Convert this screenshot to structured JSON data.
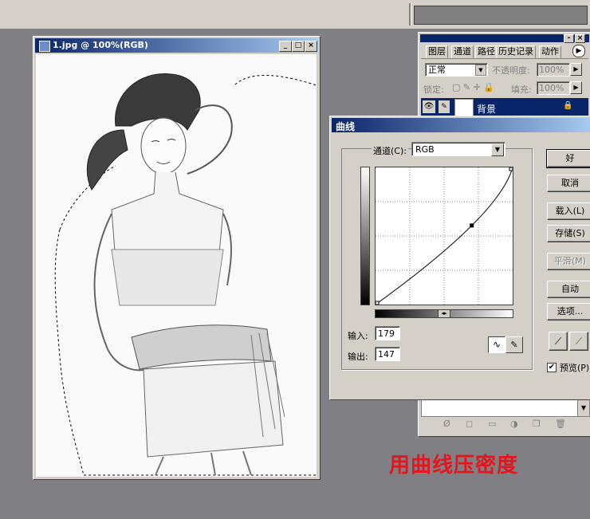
{
  "document": {
    "title": "1.jpg @ 100%(RGB)"
  },
  "layers_panel": {
    "tabs": [
      "图层",
      "通道",
      "路径",
      "历史记录",
      "动作"
    ],
    "blend_mode": "正常",
    "opacity_label": "不透明度:",
    "opacity_value": "100%",
    "lock_label": "锁定:",
    "fill_label": "填充:",
    "fill_value": "100%",
    "layer_name": "背景"
  },
  "curves": {
    "title": "曲线",
    "channel_label": "通道(C):",
    "channel_value": "RGB",
    "input_label": "输入:",
    "input_value": "179",
    "output_label": "输出:",
    "output_value": "147",
    "buttons": {
      "ok": "好",
      "cancel": "取消",
      "load": "载入(L)",
      "save": "存储(S)",
      "smooth": "平滑(M)",
      "auto": "自动",
      "options": "选项..."
    },
    "preview_label": "预览(P)",
    "preview_checked": true,
    "control_point": {
      "input": 179,
      "output": 147
    }
  },
  "caption": "用曲线压密度",
  "colors": {
    "title_bar": "#0a246a",
    "caption": "#e8141c",
    "workspace": "#807f84"
  }
}
